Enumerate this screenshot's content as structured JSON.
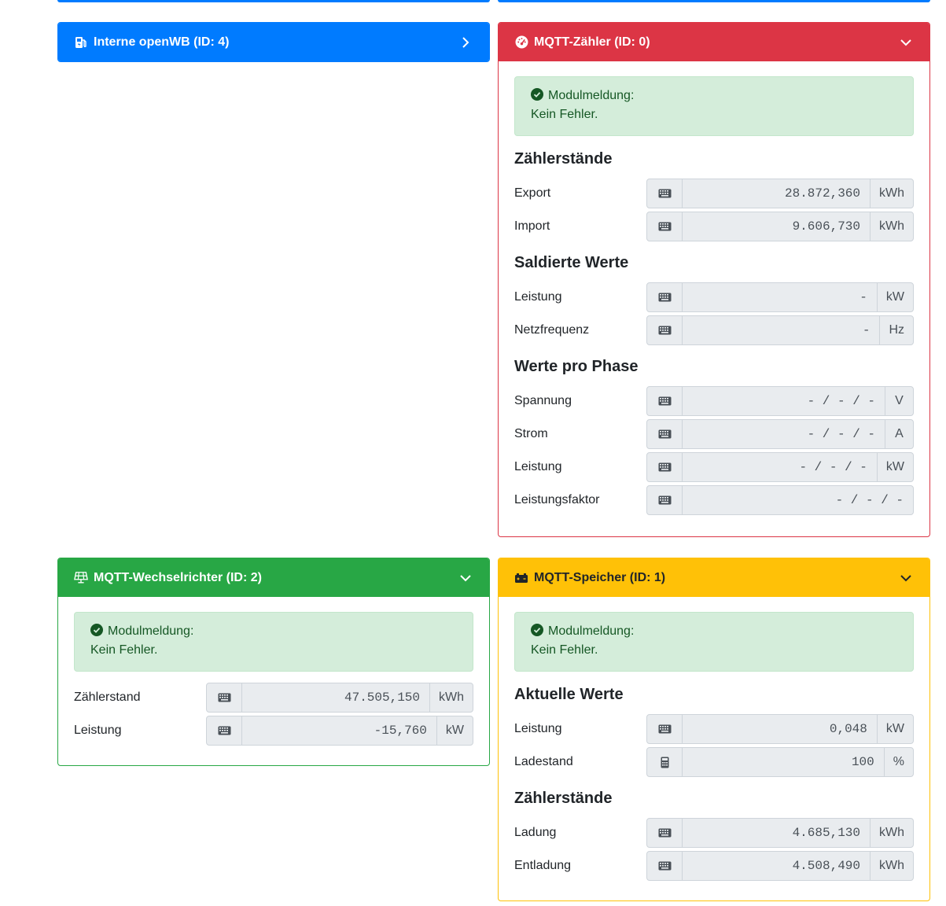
{
  "colors": {
    "primary": "#007bff",
    "danger": "#dc3545",
    "success": "#28a745",
    "warning": "#ffc107"
  },
  "cp": {
    "title": "Interne openWB (ID: 4)",
    "icon": "charging-station-icon"
  },
  "counter": {
    "title": "MQTT-Zähler (ID: 0)",
    "icon": "gauge-icon",
    "status_label": "Modulmeldung:",
    "status_text": "Kein Fehler.",
    "s1": "Zählerstände",
    "s2": "Saldierte Werte",
    "s3": "Werte pro Phase",
    "rows": [
      {
        "label": "Export",
        "value": "28.872,360",
        "unit": "kWh"
      },
      {
        "label": "Import",
        "value": "9.606,730",
        "unit": "kWh"
      },
      {
        "label": "Leistung",
        "value": "-",
        "unit": "kW"
      },
      {
        "label": "Netzfrequenz",
        "value": "-",
        "unit": "Hz"
      },
      {
        "label": "Spannung",
        "value": "- / - / -",
        "unit": "V"
      },
      {
        "label": "Strom",
        "value": "- / - / -",
        "unit": "A"
      },
      {
        "label": "Leistung",
        "value": "- / - / -",
        "unit": "kW"
      },
      {
        "label": "Leistungsfaktor",
        "value": "- / - / -"
      }
    ]
  },
  "inverter": {
    "title": "MQTT-Wechselrichter (ID: 2)",
    "icon": "solar-panel-icon",
    "status_label": "Modulmeldung:",
    "status_text": "Kein Fehler.",
    "rows": [
      {
        "label": "Zählerstand",
        "value": "47.505,150",
        "unit": "kWh"
      },
      {
        "label": "Leistung",
        "value": "-15,760",
        "unit": "kW"
      }
    ]
  },
  "battery": {
    "title": "MQTT-Speicher (ID: 1)",
    "icon": "battery-icon",
    "status_label": "Modulmeldung:",
    "status_text": "Kein Fehler.",
    "s1": "Aktuelle Werte",
    "s2": "Zählerstände",
    "rows": [
      {
        "label": "Leistung",
        "value": "0,048",
        "unit": "kW"
      },
      {
        "label": "Ladestand",
        "value": "100",
        "unit": "%"
      },
      {
        "label": "Ladung",
        "value": "4.685,130",
        "unit": "kWh"
      },
      {
        "label": "Entladung",
        "value": "4.508,490",
        "unit": "kWh"
      }
    ]
  }
}
